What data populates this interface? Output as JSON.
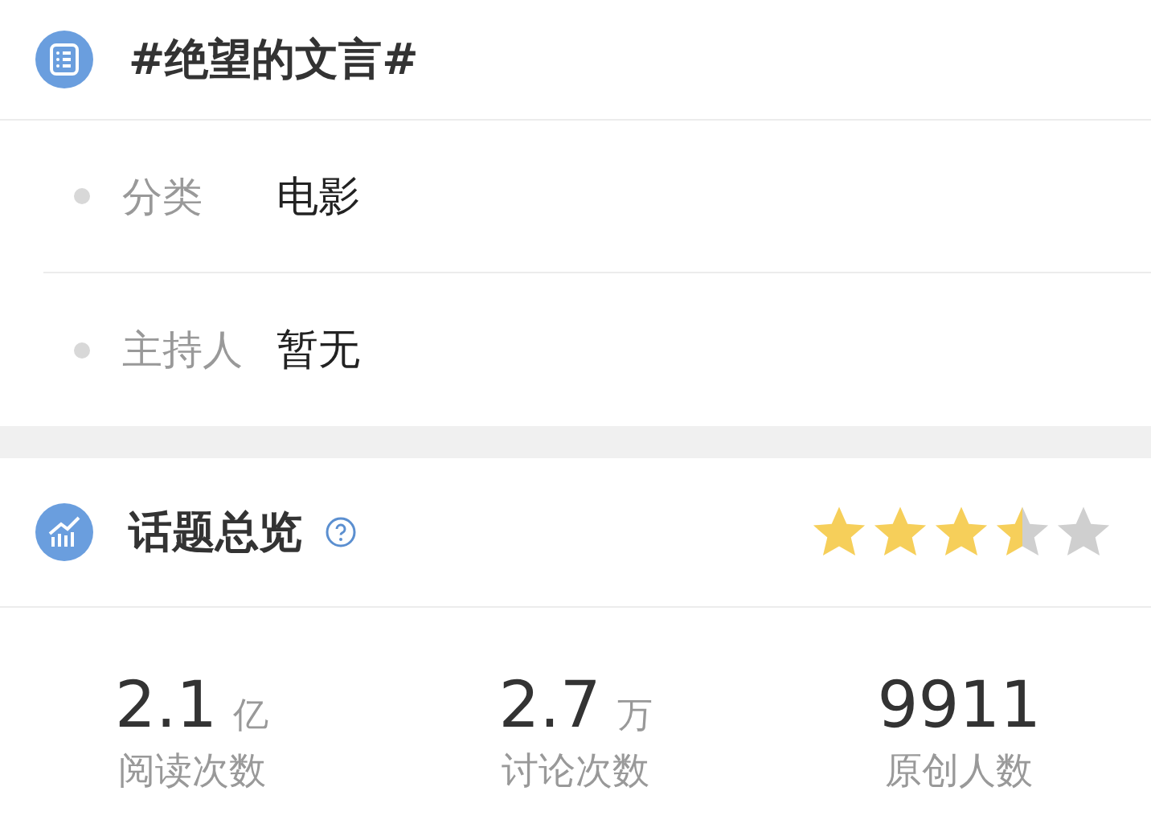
{
  "topic": {
    "title": "#绝望的文言#"
  },
  "info_rows": [
    {
      "label": "分类",
      "value": "电影"
    },
    {
      "label": "主持人",
      "value": "暂无"
    }
  ],
  "overview": {
    "title": "话题总览",
    "stars": 3.5
  },
  "stats": [
    {
      "number": "2.1",
      "unit": "亿",
      "label": "阅读次数"
    },
    {
      "number": "2.7",
      "unit": "万",
      "label": "讨论次数"
    },
    {
      "number": "9911",
      "label": "原创人数"
    }
  ]
}
